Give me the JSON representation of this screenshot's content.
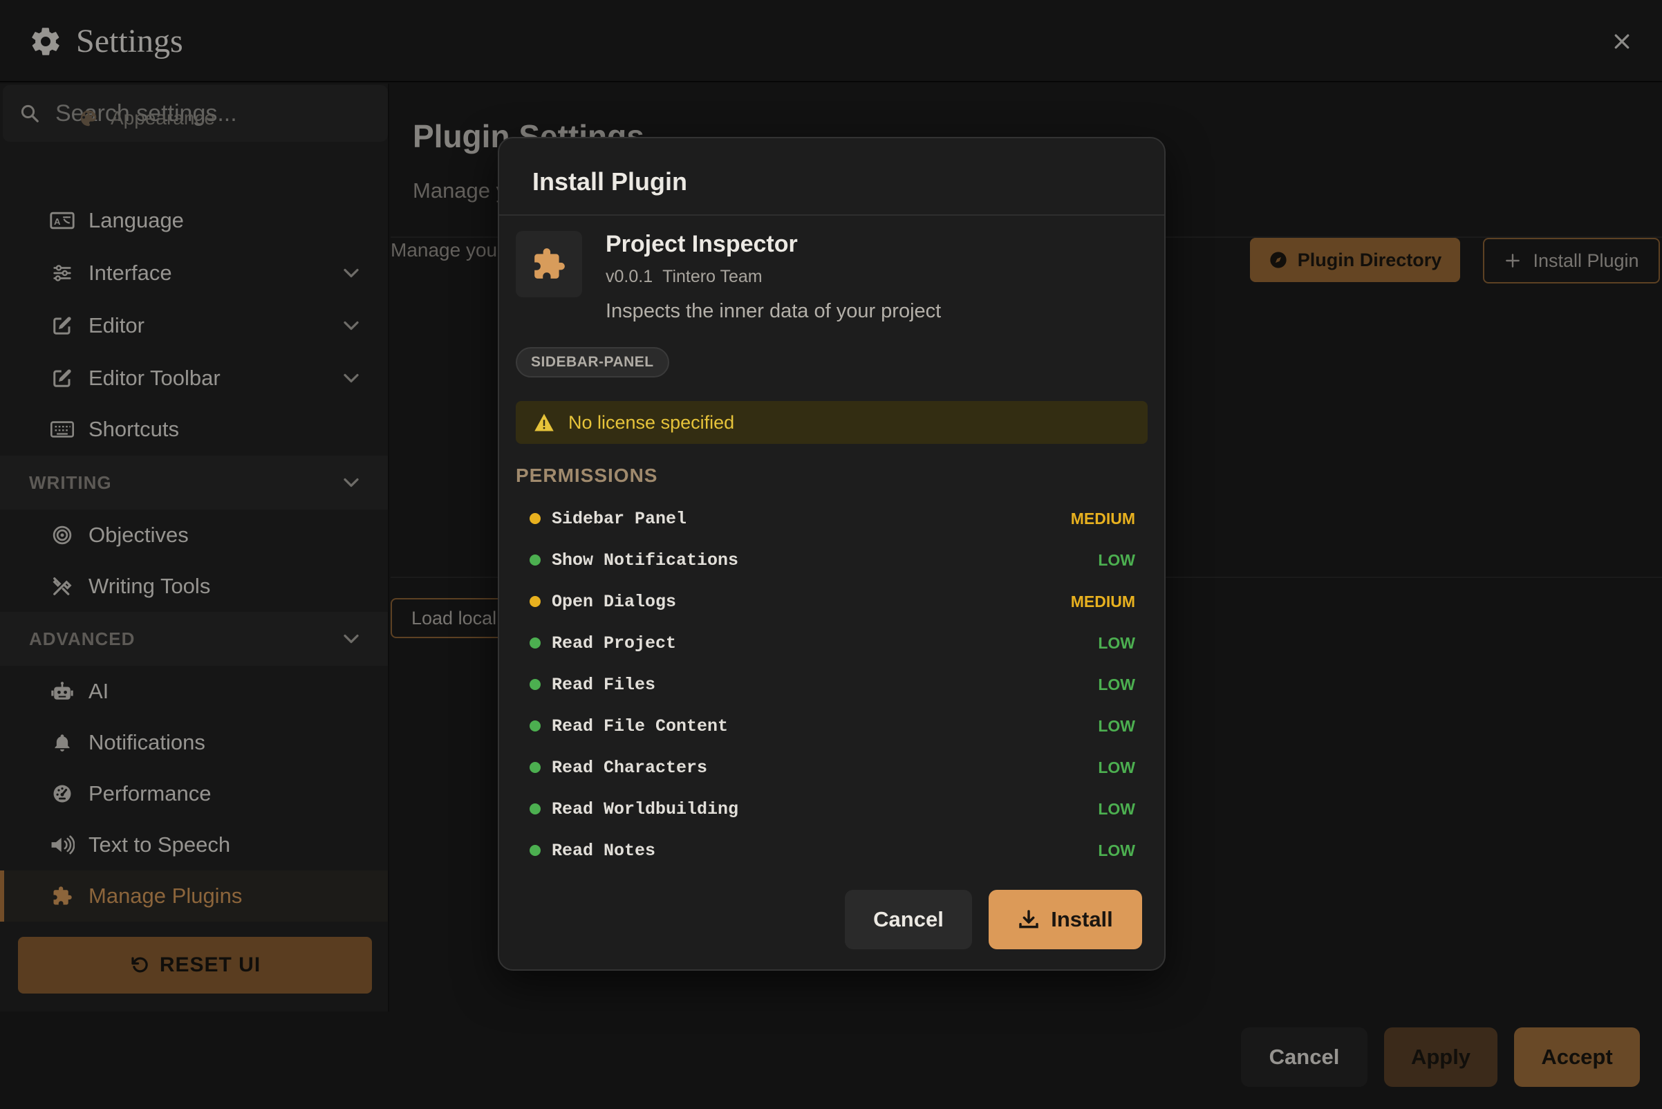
{
  "window": {
    "title": "Settings"
  },
  "sidebar": {
    "search_placeholder": "Search settings...",
    "items_top": [
      {
        "label": "Appearance",
        "icon": "palette-icon"
      },
      {
        "label": "Language",
        "icon": "language-icon"
      },
      {
        "label": "Interface",
        "icon": "sliders-icon",
        "expandable": true
      },
      {
        "label": "Editor",
        "icon": "edit-icon",
        "expandable": true
      },
      {
        "label": "Editor Toolbar",
        "icon": "edit-icon",
        "expandable": true
      },
      {
        "label": "Shortcuts",
        "icon": "keyboard-icon"
      }
    ],
    "section_writing": "WRITING",
    "items_writing": [
      {
        "label": "Objectives",
        "icon": "target-icon"
      },
      {
        "label": "Writing Tools",
        "icon": "tools-icon"
      }
    ],
    "section_advanced": "ADVANCED",
    "items_advanced": [
      {
        "label": "AI",
        "icon": "robot-icon"
      },
      {
        "label": "Notifications",
        "icon": "bell-icon"
      },
      {
        "label": "Performance",
        "icon": "gauge-icon"
      },
      {
        "label": "Text to Speech",
        "icon": "speaker-icon"
      },
      {
        "label": "Manage Plugins",
        "icon": "puzzle-icon",
        "active": true
      }
    ],
    "reset_label": "RESET UI"
  },
  "main": {
    "title": "Plugin Settings",
    "subtitle": "Manage y",
    "description": "Manage you",
    "plugin_directory_label": "Plugin Directory",
    "install_plugin_label": "Install Plugin",
    "load_local_label": "Load local"
  },
  "footer": {
    "cancel_label": "Cancel",
    "apply_label": "Apply",
    "accept_label": "Accept"
  },
  "modal": {
    "title": "Install Plugin",
    "plugin": {
      "name": "Project Inspector",
      "version": "v0.0.1",
      "author": "Tintero Team",
      "description": "Inspects the inner data of your project",
      "tag": "SIDEBAR-PANEL"
    },
    "warning": "No license specified",
    "permissions_heading": "PERMISSIONS",
    "permissions": [
      {
        "name": "Sidebar Panel",
        "risk": "MEDIUM"
      },
      {
        "name": "Show Notifications",
        "risk": "LOW"
      },
      {
        "name": "Open Dialogs",
        "risk": "MEDIUM"
      },
      {
        "name": "Read Project",
        "risk": "LOW"
      },
      {
        "name": "Read Files",
        "risk": "LOW"
      },
      {
        "name": "Read File Content",
        "risk": "LOW"
      },
      {
        "name": "Read Characters",
        "risk": "LOW"
      },
      {
        "name": "Read Worldbuilding",
        "risk": "LOW"
      },
      {
        "name": "Read Notes",
        "risk": "LOW"
      }
    ],
    "cancel_label": "Cancel",
    "install_label": "Install"
  },
  "colors": {
    "accent": "#d89c5b",
    "risk_medium": "#e8b11f",
    "risk_low": "#4caf50",
    "warning_text": "#e6c33a"
  }
}
